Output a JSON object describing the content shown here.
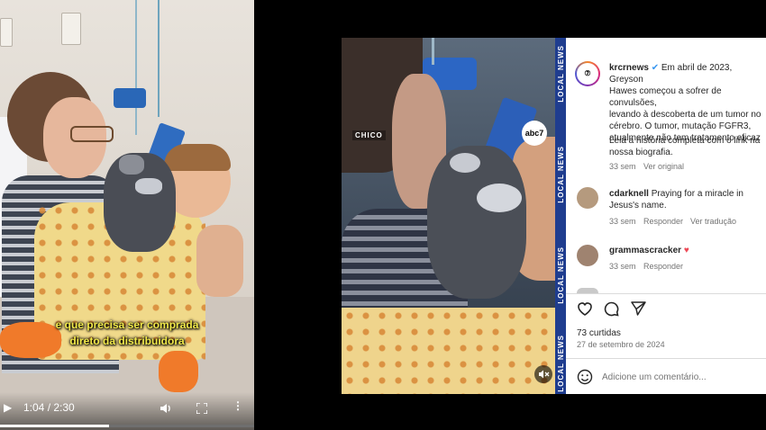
{
  "left_video": {
    "caption_line1": "e que precisa ser comprada",
    "caption_line2": "direto da distribuidora",
    "time": "1:04 / 2:30",
    "progress_fraction": 0.43
  },
  "right_video": {
    "chico_label": "CHICO",
    "abc_logo_text": "abc7",
    "side_strip_text": "LOCAL NEWS"
  },
  "post": {
    "username": "krcrnews",
    "caption": "Em abril de 2023, Greyson Hawes começou a sofrer de convulsões, levando à descoberta de um tumor no cérebro. O tumor, mutação FGFR3, atualmente não tem tratamento eficaz",
    "caption_line1": "Em abril de 2023, Greyson",
    "caption_line2": "Hawes começou a sofrer de convulsões,",
    "caption_line3": "levando à descoberta de um tumor no",
    "caption_line4": "cérebro. O tumor, mutação FGFR3,",
    "caption_line5": "atualmente não tem tratamento eficaz",
    "caption_extra_line1": "Leia a história completa com o link na",
    "caption_extra_line2": "nossa biografia.",
    "caption_age": "33 sem",
    "see_original": "Ver original",
    "likes": "73 curtidas",
    "date": "27 de setembro de 2024",
    "add_comment_placeholder": "Adicione um comentário..."
  },
  "comments": [
    {
      "username": "cdarknell",
      "text": "Praying for a miracle in",
      "text2": "Jesus's name.",
      "age": "33 sem",
      "reply": "Responder",
      "translate": "Ver tradução"
    },
    {
      "username": "grammascracker",
      "text": "♥",
      "age": "33 sem",
      "reply": "Responder"
    }
  ],
  "colors": {
    "caption_yellow": "#f1e94a",
    "news_strip_blue": "#1f3d8f",
    "ig_text": "#262626",
    "ig_meta": "#737373",
    "verified_blue": "#3897f0",
    "heart_red": "#ed4956"
  },
  "icons": [
    "play-icon",
    "volume-icon",
    "fullscreen-icon",
    "more-icon",
    "mute-icon",
    "verified-icon",
    "like-icon",
    "comment-icon",
    "share-icon",
    "emoji-icon"
  ]
}
